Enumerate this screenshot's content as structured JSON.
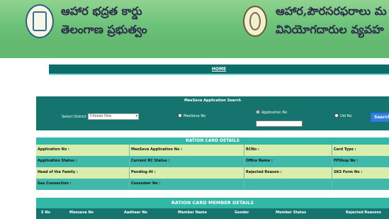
{
  "header": {
    "title_left_line1": "ఆహార భద్రత కార్డు",
    "title_left_line2": "తెలంగాణ ప్రభుత్వం",
    "title_right_line1": "ఆహార,పౌరసరఫరాలు మ",
    "title_right_line2": "వినియోగదారుల వ్యవహ"
  },
  "nav": {
    "home_label": "HOME"
  },
  "search": {
    "title": "MeeSeva Application Search",
    "district_label": "Select District :",
    "district_value": "Choose One",
    "radios": [
      {
        "label": "MeeSeva No",
        "selected": false
      },
      {
        "label": "Application No",
        "selected": true
      },
      {
        "label": "Uid No",
        "selected": false
      }
    ],
    "application_input_value": "",
    "search_button": "Search"
  },
  "ration_card": {
    "title": "RATION CARD DETAILS",
    "rows": [
      [
        "Application No :",
        "MeeSeva Application No :",
        "RCNo :",
        "Card Type :"
      ],
      [
        "Application Status :",
        "Current RC Status :",
        "Office Name :",
        "FPShop No :"
      ],
      [
        "Head of the Family :",
        "Pending At :",
        "Rejected Reason :",
        "SKS Form No :"
      ],
      [
        "Gas Connection :",
        "Consumer No :",
        "",
        ""
      ]
    ]
  },
  "members": {
    "title": "RATION CARD MEMBER DETAILS",
    "columns": [
      "S No",
      "Meeseva No",
      "Aadhaar No",
      "Member Name",
      "Gender",
      "Member Status",
      "Rejected Reasons"
    ]
  },
  "colors": {
    "banner_green": "#6ec37a",
    "dark_teal": "#16746f",
    "light_teal": "#33b7a6",
    "row_light": "#d9eeac",
    "search_button": "#2f7fd9"
  }
}
